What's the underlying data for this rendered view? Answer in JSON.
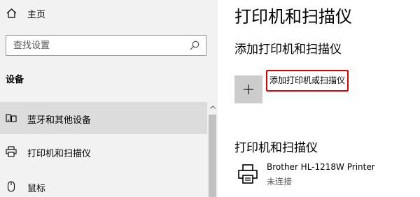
{
  "sidebar": {
    "home_label": "主页",
    "search_placeholder": "查找设置",
    "section_title": "设备",
    "items": [
      {
        "label": "蓝牙和其他设备",
        "icon": "bluetooth-devices-icon"
      },
      {
        "label": "打印机和扫描仪",
        "icon": "printer-icon"
      },
      {
        "label": "鼠标",
        "icon": "mouse-icon"
      }
    ]
  },
  "main": {
    "title": "打印机和扫描仪",
    "add_section_title": "添加打印机和扫描仪",
    "add_button_label": "添加打印机或扫描仪",
    "list_title": "打印机和扫描仪",
    "devices": [
      {
        "name": "Brother HL-1218W Printer",
        "status": "未连接",
        "icon": "printer-icon"
      }
    ]
  },
  "colors": {
    "sidebar_bg": "#f2f2f2",
    "selected_bg": "#dcdcdc",
    "highlight_border": "#e00000",
    "add_tile_bg": "#cccccc"
  }
}
